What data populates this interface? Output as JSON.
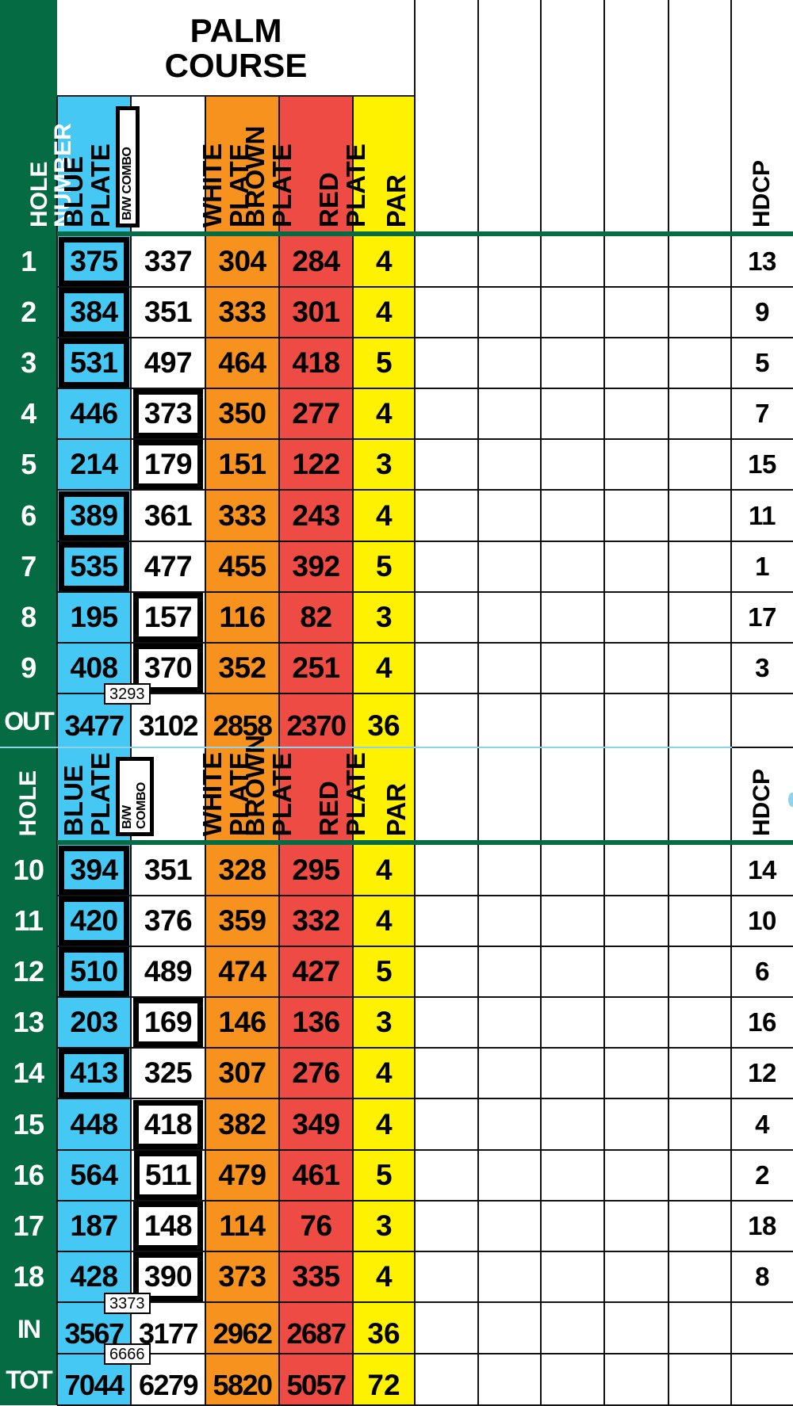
{
  "course": {
    "title_line1": "PALM",
    "title_line2": "COURSE"
  },
  "colors": {
    "green": "#056B43",
    "blue": "#45C8F4",
    "white": "#FFFFFF",
    "brown": "#F7921E",
    "red": "#EF4B45",
    "par": "#FFF200"
  },
  "headers": {
    "front_hole": "HOLE NUMBER",
    "back_hole": "HOLE",
    "blue": "BLUE PLATE",
    "combo": "B/W COMBO",
    "white": "WHITE PLATE",
    "brown": "BROWN PLATE",
    "red": "RED PLATE",
    "par": "PAR",
    "hdcp": "HDCP"
  },
  "front_nine": [
    {
      "hole": "1",
      "blue": "375",
      "white": "337",
      "brown": "304",
      "red": "284",
      "par": "4",
      "hdcp": "13",
      "combo": "blue"
    },
    {
      "hole": "2",
      "blue": "384",
      "white": "351",
      "brown": "333",
      "red": "301",
      "par": "4",
      "hdcp": "9",
      "combo": "blue"
    },
    {
      "hole": "3",
      "blue": "531",
      "white": "497",
      "brown": "464",
      "red": "418",
      "par": "5",
      "hdcp": "5",
      "combo": "blue"
    },
    {
      "hole": "4",
      "blue": "446",
      "white": "373",
      "brown": "350",
      "red": "277",
      "par": "4",
      "hdcp": "7",
      "combo": "white"
    },
    {
      "hole": "5",
      "blue": "214",
      "white": "179",
      "brown": "151",
      "red": "122",
      "par": "3",
      "hdcp": "15",
      "combo": "white"
    },
    {
      "hole": "6",
      "blue": "389",
      "white": "361",
      "brown": "333",
      "red": "243",
      "par": "4",
      "hdcp": "11",
      "combo": "blue"
    },
    {
      "hole": "7",
      "blue": "535",
      "white": "477",
      "brown": "455",
      "red": "392",
      "par": "5",
      "hdcp": "1",
      "combo": "blue"
    },
    {
      "hole": "8",
      "blue": "195",
      "white": "157",
      "brown": "116",
      "red": "82",
      "par": "3",
      "hdcp": "17",
      "combo": "white"
    },
    {
      "hole": "9",
      "blue": "408",
      "white": "370",
      "brown": "352",
      "red": "251",
      "par": "4",
      "hdcp": "3",
      "combo": "white"
    }
  ],
  "out": {
    "label": "OUT",
    "blue": "3477",
    "combo": "3293",
    "white": "3102",
    "brown": "2858",
    "red": "2370",
    "par": "36"
  },
  "back_nine": [
    {
      "hole": "10",
      "blue": "394",
      "white": "351",
      "brown": "328",
      "red": "295",
      "par": "4",
      "hdcp": "14",
      "combo": "blue"
    },
    {
      "hole": "11",
      "blue": "420",
      "white": "376",
      "brown": "359",
      "red": "332",
      "par": "4",
      "hdcp": "10",
      "combo": "blue"
    },
    {
      "hole": "12",
      "blue": "510",
      "white": "489",
      "brown": "474",
      "red": "427",
      "par": "5",
      "hdcp": "6",
      "combo": "blue"
    },
    {
      "hole": "13",
      "blue": "203",
      "white": "169",
      "brown": "146",
      "red": "136",
      "par": "3",
      "hdcp": "16",
      "combo": "white"
    },
    {
      "hole": "14",
      "blue": "413",
      "white": "325",
      "brown": "307",
      "red": "276",
      "par": "4",
      "hdcp": "12",
      "combo": "blue"
    },
    {
      "hole": "15",
      "blue": "448",
      "white": "418",
      "brown": "382",
      "red": "349",
      "par": "4",
      "hdcp": "4",
      "combo": "white"
    },
    {
      "hole": "16",
      "blue": "564",
      "white": "511",
      "brown": "479",
      "red": "461",
      "par": "5",
      "hdcp": "2",
      "combo": "white"
    },
    {
      "hole": "17",
      "blue": "187",
      "white": "148",
      "brown": "114",
      "red": "76",
      "par": "3",
      "hdcp": "18",
      "combo": "white"
    },
    {
      "hole": "18",
      "blue": "428",
      "white": "390",
      "brown": "373",
      "red": "335",
      "par": "4",
      "hdcp": "8",
      "combo": "white"
    }
  ],
  "in": {
    "label": "IN",
    "blue": "3567",
    "combo": "3373",
    "white": "3177",
    "brown": "2962",
    "red": "2687",
    "par": "36"
  },
  "tot": {
    "label": "TOT",
    "blue": "7044",
    "combo": "6666",
    "white": "6279",
    "brown": "5820",
    "red": "5057",
    "par": "72"
  }
}
